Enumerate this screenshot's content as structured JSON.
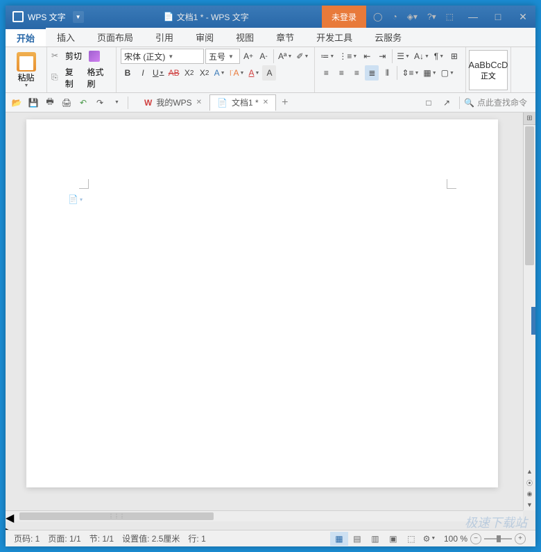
{
  "titlebar": {
    "app_name": "WPS 文字",
    "doc_title": "文档1 * - WPS 文字",
    "login_btn": "未登录"
  },
  "menu": {
    "items": [
      "开始",
      "插入",
      "页面布局",
      "引用",
      "审阅",
      "视图",
      "章节",
      "开发工具",
      "云服务"
    ],
    "active": 0
  },
  "ribbon": {
    "paste_label": "粘贴",
    "cut_label": "剪切",
    "copy_label": "复制",
    "format_painter": "格式刷",
    "font_name": "宋体 (正文)",
    "font_size": "五号",
    "style_preview": "AaBbCcD",
    "style_name": "正文"
  },
  "tabs": {
    "items": [
      {
        "icon": "wps",
        "label": "我的WPS",
        "active": false
      },
      {
        "icon": "doc",
        "label": "文档1 *",
        "active": true
      }
    ]
  },
  "search_placeholder": "点此查找命令",
  "statusbar": {
    "page_num": "页码: 1",
    "page_count": "页面: 1/1",
    "section": "节: 1/1",
    "set_value": "设置值: 2.5厘米",
    "line": "行: 1",
    "zoom": "100 %"
  },
  "watermark": "极速下载站"
}
